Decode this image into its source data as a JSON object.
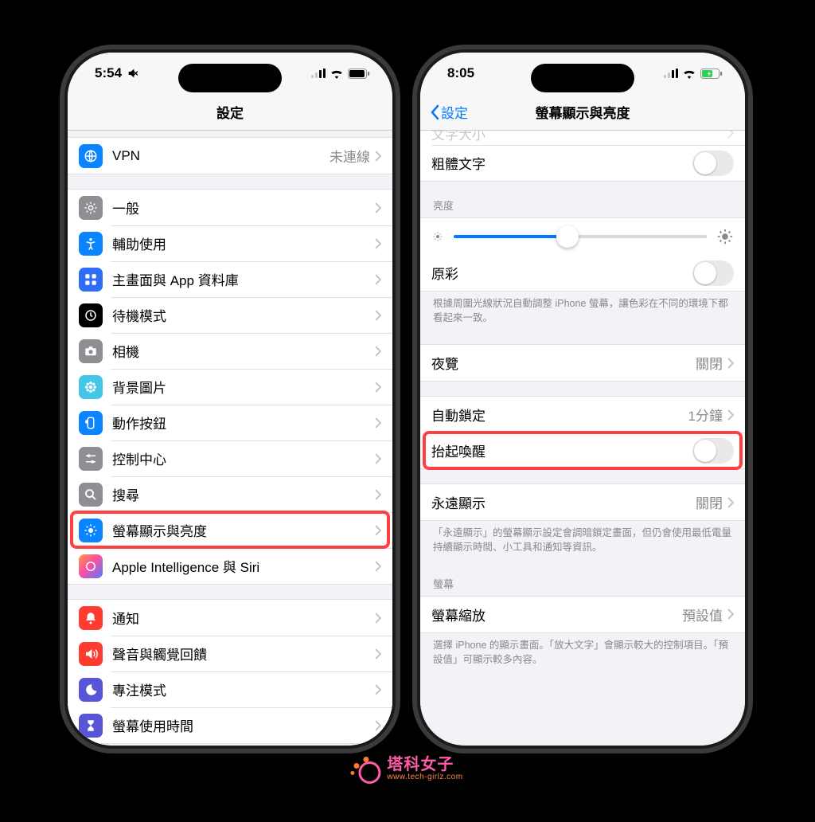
{
  "left": {
    "statusbar": {
      "time": "5:54"
    },
    "navbar": {
      "title": "設定"
    },
    "vpn": {
      "label": "VPN",
      "value": "未連線"
    },
    "items1": [
      {
        "key": "general",
        "label": "一般"
      },
      {
        "key": "access",
        "label": "輔助使用"
      },
      {
        "key": "home",
        "label": "主畫面與 App 資料庫"
      },
      {
        "key": "standby",
        "label": "待機模式"
      },
      {
        "key": "camera",
        "label": "相機"
      },
      {
        "key": "wallpaper",
        "label": "背景圖片"
      },
      {
        "key": "action",
        "label": "動作按鈕"
      },
      {
        "key": "control",
        "label": "控制中心"
      },
      {
        "key": "search",
        "label": "搜尋"
      },
      {
        "key": "display",
        "label": "螢幕顯示與亮度"
      },
      {
        "key": "ai",
        "label": "Apple Intelligence 與 Siri"
      }
    ],
    "items2": [
      {
        "key": "notif",
        "label": "通知"
      },
      {
        "key": "sound",
        "label": "聲音與觸覺回饋"
      },
      {
        "key": "focus",
        "label": "專注模式"
      },
      {
        "key": "screentime",
        "label": "螢幕使用時間"
      }
    ]
  },
  "right": {
    "statusbar": {
      "time": "8:05"
    },
    "navbar": {
      "back": "設定",
      "title": "螢幕顯示與亮度"
    },
    "top": {
      "textsize": "文字大小",
      "bold": "粗體文字"
    },
    "brightness_header": "亮度",
    "truetone": {
      "label": "原彩"
    },
    "truetone_footer": "根據周圍光線狀況自動調整 iPhone 螢幕，讓色彩在不同的環境下都看起來一致。",
    "nightshift": {
      "label": "夜覽",
      "value": "關閉"
    },
    "autolock": {
      "label": "自動鎖定",
      "value": "1分鐘"
    },
    "raise": {
      "label": "抬起喚醒"
    },
    "always": {
      "label": "永遠顯示",
      "value": "關閉"
    },
    "always_footer": "「永遠顯示」的螢幕顯示設定會調暗鎖定畫面，但仍會使用最低電量持續顯示時間、小工具和通知等資訊。",
    "screen_header": "螢幕",
    "zoom": {
      "label": "螢幕縮放",
      "value": "預設值"
    },
    "zoom_footer": "選擇 iPhone 的顯示畫面。「放大文字」會顯示較大的控制項目。「預設值」可顯示較多內容。"
  },
  "watermark": {
    "line1": "塔科女子",
    "line2": "www.tech-girlz.com"
  }
}
